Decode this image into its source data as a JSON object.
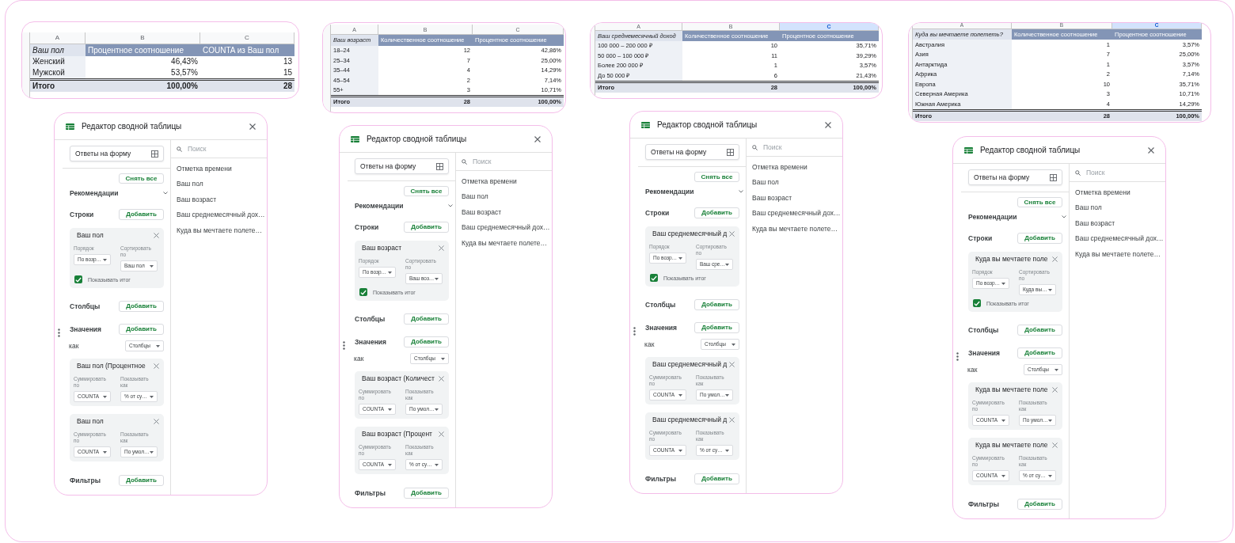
{
  "panels": [
    {
      "table": {
        "column_letters": [
          {
            "label": "A",
            "selected": false
          },
          {
            "label": "B",
            "selected": false
          },
          {
            "label": "C",
            "selected": false
          }
        ],
        "header": [
          "Ваш пол",
          "Процентное соотношение",
          "COUNTA из Ваш пол"
        ],
        "rows": [
          [
            "Женский",
            "46,43%",
            "13"
          ],
          [
            "Мужской",
            "53,57%",
            "15"
          ]
        ],
        "total": [
          "Итого",
          "100,00%",
          "28"
        ]
      },
      "editor": {
        "title": "Редактор сводной таблицы",
        "source": "Ответы на форму",
        "clear_all": "Снять все",
        "recommendations": {
          "label": "Рекомендации",
          "expanded": false
        },
        "rows_section": {
          "label": "Строки",
          "add": "Добавить",
          "fields": [
            {
              "title": "Ваш пол",
              "order_label": "Порядок",
              "order": "По возр…",
              "sort_label": "Сортировать по",
              "sort": "Ваш пол",
              "show_totals_label": "Показывать итог",
              "show_totals": true
            }
          ]
        },
        "columns_section": {
          "label": "Столбцы",
          "add": "Добавить"
        },
        "values_section": {
          "label": "Значения",
          "add": "Добавить",
          "layout_label": "как",
          "layout": "Столбцы",
          "fields": [
            {
              "title": "Ваш пол (Процентное",
              "summarize_label": "Суммировать по",
              "summarize": "COUNTA",
              "show_as_label": "Показывать как",
              "show_as": "% от су…"
            },
            {
              "title": "Ваш пол",
              "summarize_label": "Суммировать по",
              "summarize": "COUNTA",
              "show_as_label": "Показывать как",
              "show_as": "По умол…"
            }
          ]
        },
        "filters_section": {
          "label": "Фильтры",
          "add": "Добавить"
        },
        "search": {
          "placeholder": "Поиск"
        },
        "field_list": [
          "Отметка времени",
          "Ваш пол",
          "Ваш возраст",
          "Ваш среднемесячный дох…",
          "Куда вы мечтаете полете…"
        ]
      }
    },
    {
      "table": {
        "column_letters": [
          {
            "label": "A",
            "selected": false
          },
          {
            "label": "B",
            "selected": false
          },
          {
            "label": "C",
            "selected": false
          }
        ],
        "header": [
          "Ваш возраст",
          "Количественное соотношение",
          "Процентное соотношение"
        ],
        "rows": [
          [
            "18–24",
            "12",
            "42,86%"
          ],
          [
            "25–34",
            "7",
            "25,00%"
          ],
          [
            "35–44",
            "4",
            "14,29%"
          ],
          [
            "45–54",
            "2",
            "7,14%"
          ],
          [
            "55+",
            "3",
            "10,71%"
          ]
        ],
        "total": [
          "Итого",
          "28",
          "100,00%"
        ]
      },
      "editor": {
        "title": "Редактор сводной таблицы",
        "source": "Ответы на форму",
        "clear_all": "Снять все",
        "recommendations": {
          "label": "Рекомендации",
          "expanded": false
        },
        "rows_section": {
          "label": "Строки",
          "add": "Добавить",
          "fields": [
            {
              "title": "Ваш возраст",
              "order_label": "Порядок",
              "order": "По возр…",
              "sort_label": "Сортировать по",
              "sort": "Ваш воз…",
              "show_totals_label": "Показывать итог",
              "show_totals": true
            }
          ]
        },
        "columns_section": {
          "label": "Столбцы",
          "add": "Добавить"
        },
        "values_section": {
          "label": "Значения",
          "add": "Добавить",
          "layout_label": "как",
          "layout": "Столбцы",
          "fields": [
            {
              "title": "Ваш возраст (Количест",
              "summarize_label": "Суммировать по",
              "summarize": "COUNTA",
              "show_as_label": "Показывать как",
              "show_as": "По умол…"
            },
            {
              "title": "Ваш возраст (Процент",
              "summarize_label": "Суммировать по",
              "summarize": "COUNTA",
              "show_as_label": "Показывать как",
              "show_as": "% от су…"
            }
          ]
        },
        "filters_section": {
          "label": "Фильтры",
          "add": "Добавить"
        },
        "search": {
          "placeholder": "Поиск"
        },
        "field_list": [
          "Отметка времени",
          "Ваш пол",
          "Ваш возраст",
          "Ваш среднемесячный дох…",
          "Куда вы мечтаете полете…"
        ]
      }
    },
    {
      "table": {
        "column_letters": [
          {
            "label": "A",
            "selected": false
          },
          {
            "label": "B",
            "selected": false
          },
          {
            "label": "C",
            "selected": true
          }
        ],
        "header": [
          "Ваш среднемесячный доход",
          "Количественное соотношение",
          "Процентное соотношение"
        ],
        "rows": [
          [
            "100 000 – 200 000 ₽",
            "10",
            "35,71%"
          ],
          [
            "50 000 – 100 000 ₽",
            "11",
            "39,29%"
          ],
          [
            "Более 200 000 ₽",
            "1",
            "3,57%"
          ],
          [
            "До 50 000 ₽",
            "6",
            "21,43%"
          ]
        ],
        "total": [
          "Итого",
          "28",
          "100,00%"
        ]
      },
      "editor": {
        "title": "Редактор сводной таблицы",
        "source": "Ответы на форму",
        "clear_all": "Снять все",
        "recommendations": {
          "label": "Рекомендации",
          "expanded": false
        },
        "rows_section": {
          "label": "Строки",
          "add": "Добавить",
          "fields": [
            {
              "title": "Ваш среднемесячный д",
              "order_label": "Порядок",
              "order": "По возр…",
              "sort_label": "Сортировать по",
              "sort": "Ваш сре…",
              "show_totals_label": "Показывать итог",
              "show_totals": true
            }
          ]
        },
        "columns_section": {
          "label": "Столбцы",
          "add": "Добавить"
        },
        "values_section": {
          "label": "Значения",
          "add": "Добавить",
          "layout_label": "как",
          "layout": "Столбцы",
          "fields": [
            {
              "title": "Ваш среднемесячный д",
              "summarize_label": "Суммировать по",
              "summarize": "COUNTA",
              "show_as_label": "Показывать как",
              "show_as": "По умол…"
            },
            {
              "title": "Ваш среднемесячный д",
              "summarize_label": "Суммировать по",
              "summarize": "COUNTA",
              "show_as_label": "Показывать как",
              "show_as": "% от су…"
            }
          ]
        },
        "filters_section": {
          "label": "Фильтры",
          "add": "Добавить"
        },
        "search": {
          "placeholder": "Поиск"
        },
        "field_list": [
          "Отметка времени",
          "Ваш пол",
          "Ваш возраст",
          "Ваш среднемесячный дох…",
          "Куда вы мечтаете полете…"
        ]
      }
    },
    {
      "table": {
        "column_letters": [
          {
            "label": "A",
            "selected": false
          },
          {
            "label": "B",
            "selected": false
          },
          {
            "label": "C",
            "selected": true
          }
        ],
        "header": [
          "Куда вы мечтаете полететь?",
          "Количественное соотношение",
          "Процентное соотношение"
        ],
        "rows": [
          [
            "Австралия",
            "1",
            "3,57%"
          ],
          [
            "Азия",
            "7",
            "25,00%"
          ],
          [
            "Антарктида",
            "1",
            "3,57%"
          ],
          [
            "Африка",
            "2",
            "7,14%"
          ],
          [
            "Европа",
            "10",
            "35,71%"
          ],
          [
            "Северная Америка",
            "3",
            "10,71%"
          ],
          [
            "Южная Америка",
            "4",
            "14,29%"
          ]
        ],
        "total": [
          "Итого",
          "28",
          "100,00%"
        ]
      },
      "editor": {
        "title": "Редактор сводной таблицы",
        "source": "Ответы на форму",
        "clear_all": "Снять все",
        "recommendations": {
          "label": "Рекомендации",
          "expanded": false
        },
        "rows_section": {
          "label": "Строки",
          "add": "Добавить",
          "fields": [
            {
              "title": "Куда вы мечтаете поле",
              "order_label": "Порядок",
              "order": "По возр…",
              "sort_label": "Сортировать по",
              "sort": "Куда вы…",
              "show_totals_label": "Показывать итог",
              "show_totals": true
            }
          ]
        },
        "columns_section": {
          "label": "Столбцы",
          "add": "Добавить"
        },
        "values_section": {
          "label": "Значения",
          "add": "Добавить",
          "layout_label": "как",
          "layout": "Столбцы",
          "fields": [
            {
              "title": "Куда вы мечтаете поле",
              "summarize_label": "Суммировать по",
              "summarize": "COUNTA",
              "show_as_label": "Показывать как",
              "show_as": "По умол…"
            },
            {
              "title": "Куда вы мечтаете поле",
              "summarize_label": "Суммировать по",
              "summarize": "COUNTA",
              "show_as_label": "Показывать как",
              "show_as": "% от су…"
            }
          ]
        },
        "filters_section": {
          "label": "Фильтры",
          "add": "Добавить"
        },
        "search": {
          "placeholder": "Поиск"
        },
        "field_list": [
          "Отметка времени",
          "Ваш пол",
          "Ваш возраст",
          "Ваш среднемесячный дох…",
          "Куда вы мечтаете полете…"
        ]
      }
    }
  ]
}
